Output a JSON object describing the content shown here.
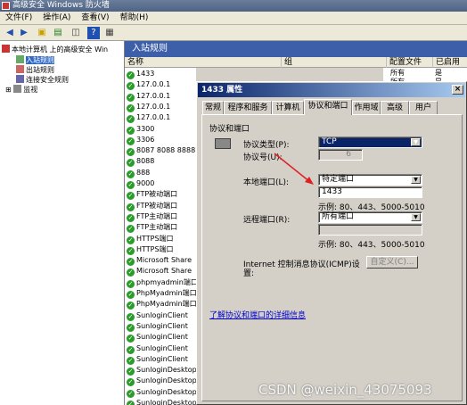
{
  "window": {
    "title": "高级安全 Windows 防火墙"
  },
  "menu": [
    "文件(F)",
    "操作(A)",
    "查看(V)",
    "帮助(H)"
  ],
  "tree": {
    "root": "本地计算机 上的高级安全 Win",
    "items": [
      "入站规则",
      "出站规则",
      "连接安全规则",
      "监视"
    ]
  },
  "rules": {
    "header": "入站规则",
    "columns": [
      "名称",
      "组",
      "配置文件",
      "已启用"
    ],
    "names": [
      "1433",
      "127.0.0.1",
      "127.0.0.1",
      "127.0.0.1",
      "127.0.0.1",
      "3300",
      "3306",
      "8087 8088 8888",
      "8088",
      "888",
      "9000",
      "FTP被动端口",
      "FTP被动端口",
      "FTP主动端口",
      "FTP主动端口",
      "HTTPS端口",
      "HTTPS端口",
      "Microsoft Share",
      "Microsoft Share",
      "phpmyadmin端口",
      "PhpMyadmin端口",
      "PhpMyadmin端口",
      "SunloginClient",
      "SunloginClient",
      "SunloginClient",
      "SunloginClient",
      "SunloginClient",
      "SunloginDesktop",
      "SunloginDesktop",
      "SunloginDesktop",
      "SunloginDesktop"
    ],
    "right_rows": [
      {
        "profile": "所有",
        "enabled": "是"
      },
      {
        "profile": "所有",
        "enabled": "是"
      }
    ]
  },
  "dialog": {
    "title": "1433 属性",
    "close": "×",
    "tabs": [
      "常规",
      "程序和服务",
      "计算机",
      "协议和端口",
      "作用域",
      "高级",
      "用户"
    ],
    "group_label": "协议和端口",
    "protocol_type_label": "协议类型(P):",
    "protocol_type_value": "TCP",
    "protocol_number_label": "协议号(U):",
    "protocol_number_value": "6",
    "local_port_label": "本地端口(L):",
    "local_port_select": "特定端口",
    "local_port_value": "1433",
    "local_port_example": "示例: 80、443、5000-5010",
    "remote_port_label": "远程端口(R):",
    "remote_port_select": "所有端口",
    "remote_port_example": "示例: 80、443、5000-5010",
    "icmp_label_line1": "Internet 控制消息协议(ICMP)设",
    "icmp_label_line2": "置:",
    "icmp_button": "自定义(C)...",
    "more_link": "了解协议和端口的详细信息"
  },
  "watermark": "CSDN @weixin_43075093"
}
